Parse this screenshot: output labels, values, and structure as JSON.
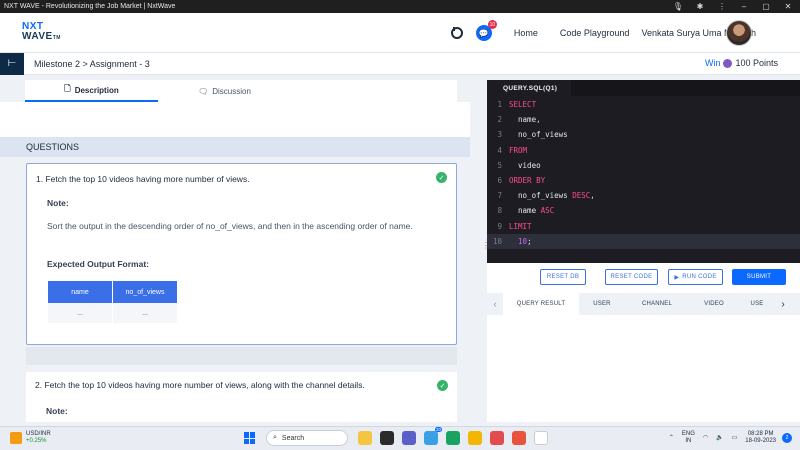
{
  "window": {
    "title": "NXT WAVE - Revolutionizing the Job Market | NxtWave"
  },
  "header": {
    "logo_line1": "NXT",
    "logo_line2": "WAVE",
    "logo_tm": "TM",
    "chat_badge": "10",
    "nav": [
      "Home",
      "Code Playground"
    ],
    "username": "Venkata Surya Uma Mahesh"
  },
  "breadcrumb": {
    "text": "Milestone 2 > Assignment - 3",
    "win_label": "Win",
    "points": "100 Points"
  },
  "left_tabs": {
    "description": "Description",
    "discussion": "Discussion"
  },
  "questions": {
    "header": "QUESTIONS",
    "q1": {
      "title": "1.  Fetch the top 10 videos having more number of views.",
      "note_label": "Note:",
      "note_text": "Sort the output in the descending order of no_of_views, and then in the ascending order of name.",
      "expected_label": "Expected Output Format:",
      "table_headers": [
        "name",
        "no_of_views"
      ],
      "table_row": [
        "...",
        "..."
      ]
    },
    "q2": {
      "title": "2.  Fetch the top 10 videos having more number of views, along with the channel details.",
      "note_label": "Note:"
    }
  },
  "editor": {
    "tab": "QUERY.SQL(Q1)",
    "lines": [
      {
        "n": "1",
        "t": "SELECT"
      },
      {
        "n": "2",
        "t": "  name,"
      },
      {
        "n": "3",
        "t": "  no_of_views"
      },
      {
        "n": "4",
        "t": "FROM"
      },
      {
        "n": "5",
        "t": "  video"
      },
      {
        "n": "6",
        "t": "ORDER BY"
      },
      {
        "n": "7",
        "t": "  no_of_views DESC,"
      },
      {
        "n": "8",
        "t": "  name ASC"
      },
      {
        "n": "9",
        "t": "LIMIT"
      },
      {
        "n": "10",
        "t": "  10;"
      }
    ]
  },
  "buttons": {
    "reset_db": "RESET DB",
    "reset_code": "RESET CODE",
    "run_code": "RUN CODE",
    "submit": "SUBMIT"
  },
  "result_tabs": [
    "QUERY RESULT",
    "USER",
    "CHANNEL",
    "VIDEO",
    "USE"
  ],
  "taskbar": {
    "stock_name": "USD/INR",
    "stock_change": "+0.25%",
    "search": "Search",
    "badge": "20",
    "lang1": "ENG",
    "lang2": "IN",
    "time": "08:28 PM",
    "date": "18-09-2023",
    "notif": "2"
  },
  "colors": {
    "accent": "#0b69ff",
    "success": "#37b36b",
    "editor_bg": "#1c1c22",
    "keyword": "#ff4d8d"
  }
}
